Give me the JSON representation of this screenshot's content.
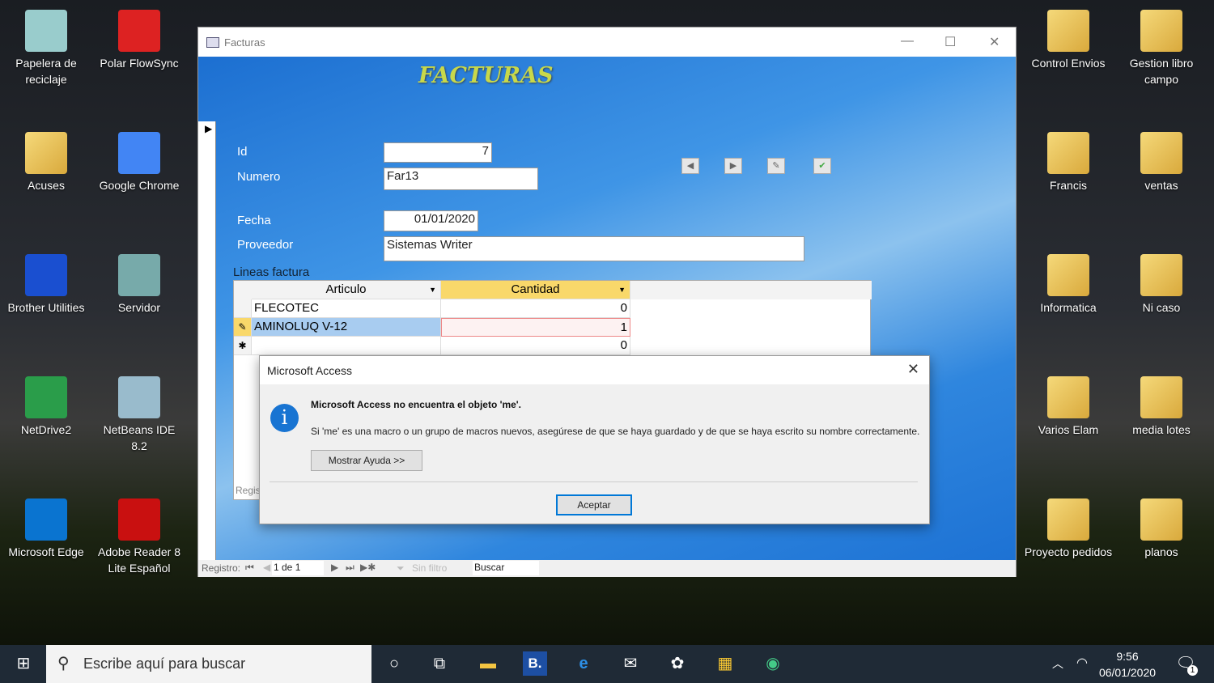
{
  "desktop_left": [
    {
      "label": "Papelera de reciclaje",
      "icon": "recycle-bin-icon",
      "color": "#9cc"
    },
    {
      "label": "Polar FlowSync",
      "icon": "polar-flowsync-icon",
      "color": "#d22"
    },
    {
      "label": "Acuses",
      "icon": "folder-icon",
      "color": "folder"
    },
    {
      "label": "Google Chrome",
      "icon": "chrome-icon",
      "color": "#4285f4"
    },
    {
      "label": "Brother Utilities",
      "icon": "brother-utilities-icon",
      "color": "#1a4fd0"
    },
    {
      "label": "Servidor",
      "icon": "server-icon",
      "color": "#7aa"
    },
    {
      "label": "NetDrive2",
      "icon": "netdrive-icon",
      "color": "#2a9d4a"
    },
    {
      "label": "NetBeans IDE 8.2",
      "icon": "netbeans-icon",
      "color": "#9bc"
    },
    {
      "label": "Microsoft Edge",
      "icon": "edge-icon",
      "color": "#0a74d0"
    },
    {
      "label": "Adobe Reader 8 Lite Español",
      "icon": "adobe-reader-icon",
      "color": "#c91010"
    }
  ],
  "desktop_right": [
    {
      "label": "Control Envios",
      "icon": "folder-icon"
    },
    {
      "label": "Gestion libro campo",
      "icon": "folder-icon"
    },
    {
      "label": "Francis",
      "icon": "folder-icon"
    },
    {
      "label": "ventas",
      "icon": "folder-icon"
    },
    {
      "label": "Informatica",
      "icon": "folder-icon"
    },
    {
      "label": "Ni caso",
      "icon": "folder-icon"
    },
    {
      "label": "Varios Elam",
      "icon": "folder-icon"
    },
    {
      "label": "media lotes",
      "icon": "folder-icon"
    },
    {
      "label": "Proyecto pedidos",
      "icon": "folder-icon"
    },
    {
      "label": "planos",
      "icon": "folder-icon"
    }
  ],
  "window": {
    "title": "Facturas"
  },
  "form": {
    "heading": "FACTURAS",
    "id_label": "Id",
    "id_value": "7",
    "numero_label": "Numero",
    "numero_value": "Far13",
    "fecha_label": "Fecha",
    "fecha_value": "01/01/2020",
    "proveedor_label": "Proveedor",
    "proveedor_value": "Sistemas Writer",
    "lineas_label": "Lineas factura",
    "columns": [
      "Articulo",
      "Cantidad"
    ],
    "rows": [
      {
        "articulo": "FLECOTEC",
        "cantidad": "0",
        "marker": ""
      },
      {
        "articulo": "AMINOLUQ V-12",
        "cantidad": "1",
        "marker": "✎"
      },
      {
        "articulo": "",
        "cantidad": "0",
        "marker": "✱"
      }
    ],
    "sub_status": "Regis"
  },
  "status": {
    "registro_label": "Registro:",
    "record": "1 de 1",
    "filter": "Sin filtro",
    "search": "Buscar"
  },
  "dialog": {
    "title": "Microsoft Access",
    "main": "Microsoft Access no encuentra el objeto 'me'.",
    "detail": "Si 'me' es una macro o un grupo de macros nuevos, asegúrese de que se haya guardado y de que se haya escrito su nombre correctamente.",
    "help_button": "Mostrar Ayuda >>",
    "ok_button": "Aceptar"
  },
  "taskbar": {
    "search_placeholder": "Escribe aquí para buscar",
    "time": "9:56",
    "date": "06/01/2020",
    "notifications": "1"
  }
}
